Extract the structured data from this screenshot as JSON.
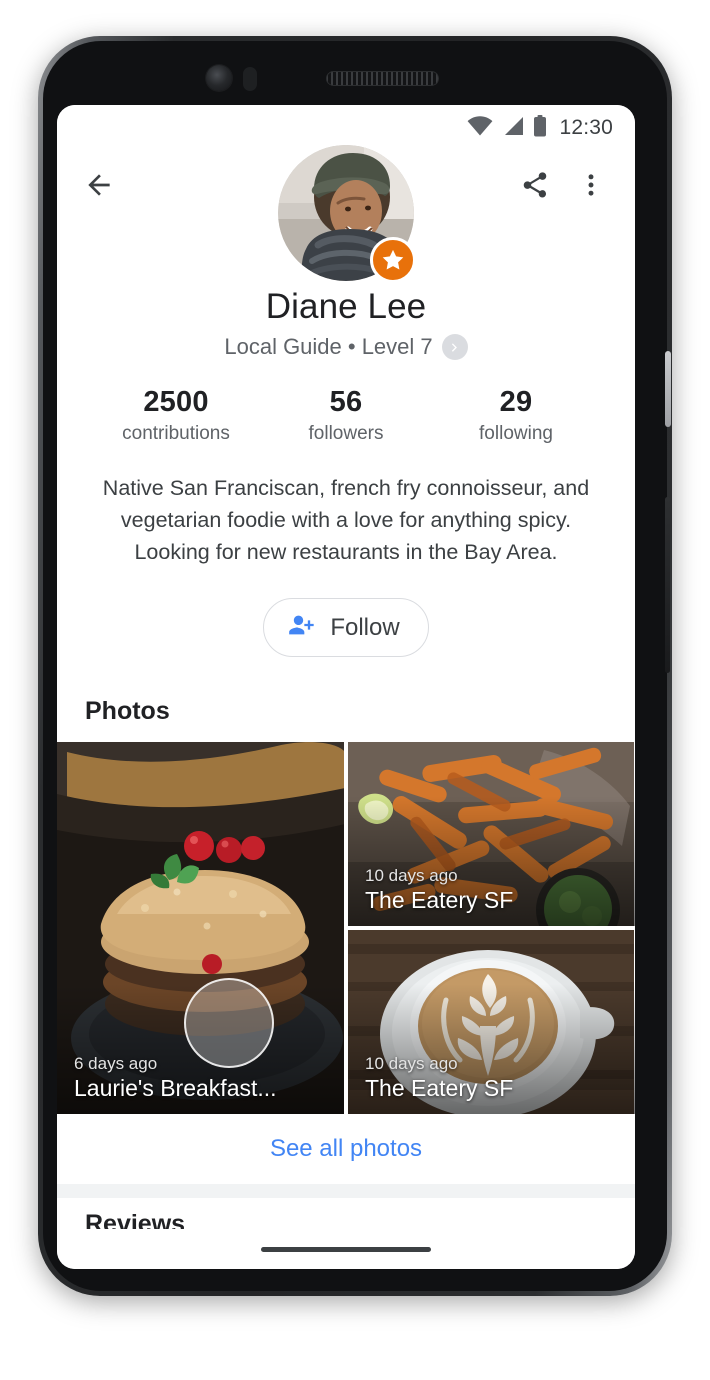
{
  "status_bar": {
    "wifi_icon": "wifi-icon",
    "signal_icon": "cell-signal-icon",
    "battery_icon": "battery-icon",
    "time": "12:30"
  },
  "app_bar": {
    "back_icon": "back-arrow-icon",
    "share_icon": "share-icon",
    "overflow_icon": "more-vert-icon"
  },
  "profile": {
    "avatar_alt": "avatar",
    "badge_icon": "local-guide-star-badge-icon",
    "badge_color": "#e8710a",
    "name": "Diane Lee",
    "guide_level": "Local Guide • Level 7",
    "chevron_icon": "chevron-right-icon",
    "stats": [
      {
        "value": "2500",
        "label": "contributions"
      },
      {
        "value": "56",
        "label": "followers"
      },
      {
        "value": "29",
        "label": "following"
      }
    ],
    "bio": "Native San Franciscan, french fry connoisseur, and vegetarian foodie with a love for anything spicy. Looking for new restaurants in the Bay Area.",
    "follow": {
      "icon": "person-add-icon",
      "label": "Follow",
      "icon_color": "#4285f4"
    }
  },
  "photos_section": {
    "title": "Photos",
    "items": [
      {
        "when": "6 days ago",
        "place": "Laurie's Breakfast...",
        "subject": "berry crumble dessert"
      },
      {
        "when": "10 days ago",
        "place": "The Eatery SF",
        "subject": "sweet potato fries with dip"
      },
      {
        "when": "10 days ago",
        "place": "The Eatery SF",
        "subject": "latte art cappuccino"
      }
    ],
    "see_all_label": "See all photos",
    "see_all_color": "#4285f4"
  },
  "reviews_section": {
    "title": "Reviews"
  },
  "system_nav": {
    "home_indicator": "home-indicator"
  }
}
